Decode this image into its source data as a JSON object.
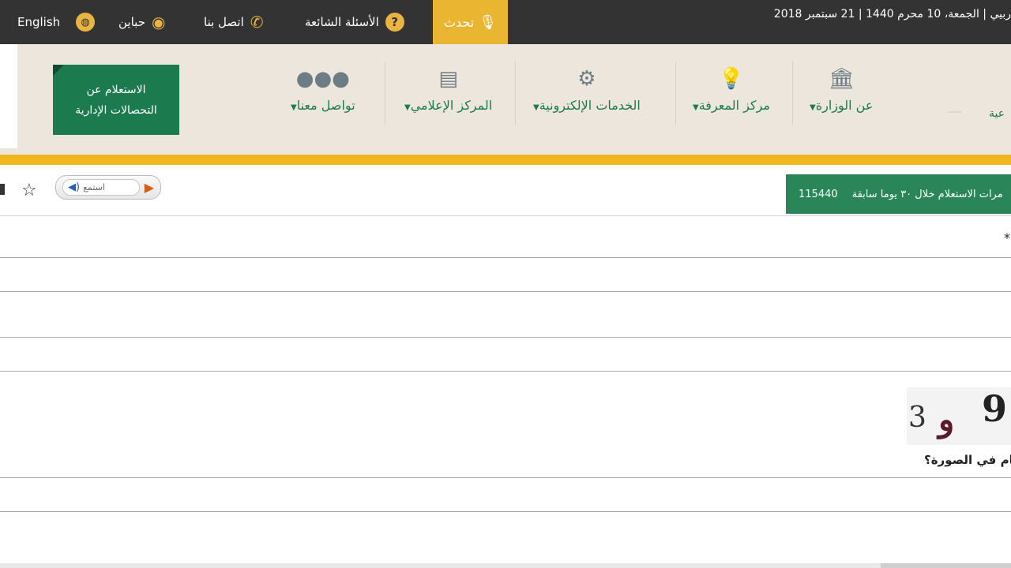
{
  "topbar": {
    "date_text": "ربيي | الجمعة، 10 محرم 1440 | 21 سبتمبر 2018",
    "talk_label": "تحدث",
    "faq_label": "الأسئلة الشائعة",
    "contact_label": "اتصل بنا",
    "accessibility_label": "حباين",
    "language_label": "English"
  },
  "nav": {
    "items": [
      {
        "label": "عن الوزارة"
      },
      {
        "label": "مركز المعرفة"
      },
      {
        "label": "الخدمات الإلكترونية"
      },
      {
        "label": "المركز الإعلامي"
      },
      {
        "label": "تواصل معنا"
      }
    ],
    "inquiry_line1": "الاستعلام عن",
    "inquiry_line2": "التحصالات الإدارية",
    "logo_text": "عية"
  },
  "toolbar": {
    "stats_text": "مرات الاستعلام خلال ٣٠ يوما سابقة",
    "stats_count": "115440",
    "listen_label": "استمع"
  },
  "form": {
    "required_mark": "*",
    "captcha_chars": [
      "3",
      "و",
      "9"
    ],
    "captcha_question": "* نام في الصورة؟"
  }
}
